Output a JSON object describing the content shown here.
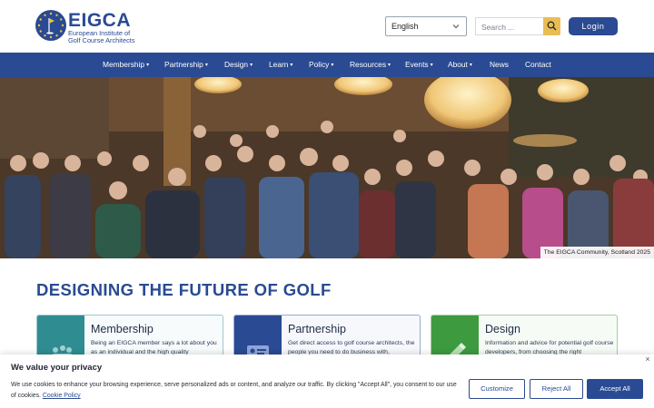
{
  "brand": {
    "name": "EIGCA",
    "subtitle_line1": "European Institute of",
    "subtitle_line2": "Golf Course Architects",
    "color": "#2a4a93"
  },
  "header": {
    "language_selected": "English",
    "search_placeholder": "Search ...",
    "login_label": "Login"
  },
  "nav": {
    "items": [
      {
        "label": "Membership",
        "dropdown": true
      },
      {
        "label": "Partnership",
        "dropdown": true
      },
      {
        "label": "Design",
        "dropdown": true
      },
      {
        "label": "Learn",
        "dropdown": true
      },
      {
        "label": "Policy",
        "dropdown": true
      },
      {
        "label": "Resources",
        "dropdown": true
      },
      {
        "label": "Events",
        "dropdown": true
      },
      {
        "label": "About",
        "dropdown": true
      },
      {
        "label": "News",
        "dropdown": false
      },
      {
        "label": "Contact",
        "dropdown": false
      }
    ],
    "caret": "▾"
  },
  "hero": {
    "caption": "The EIGCA Community, Scotland 2025"
  },
  "main": {
    "title": "DESIGNING THE FUTURE OF GOLF",
    "cards": [
      {
        "title": "Membership",
        "text": "Being an EIGCA member says a lot about you as an individual and the high quality",
        "thumb_color": "#2f8d92",
        "border_color": "#9fc6cb"
      },
      {
        "title": "Partnership",
        "text": "Get direct access to golf course architects, the people you need to do business with,",
        "thumb_color": "#2a4a93",
        "border_color": "#9aa9cf"
      },
      {
        "title": "Design",
        "text": "Information and advice for potential golf course developers, from choosing the right",
        "thumb_color": "#3d9a3f",
        "border_color": "#a6cfa0"
      }
    ]
  },
  "cookie": {
    "title": "We value your privacy",
    "text": "We use cookies to enhance your browsing experience, serve personalized ads or content, and analyze our traffic. By clicking \"Accept All\", you consent to our use of cookies.",
    "policy_link": "Cookie Policy",
    "close_icon": "×",
    "customize_label": "Customize",
    "reject_label": "Reject All",
    "accept_label": "Accept All"
  }
}
